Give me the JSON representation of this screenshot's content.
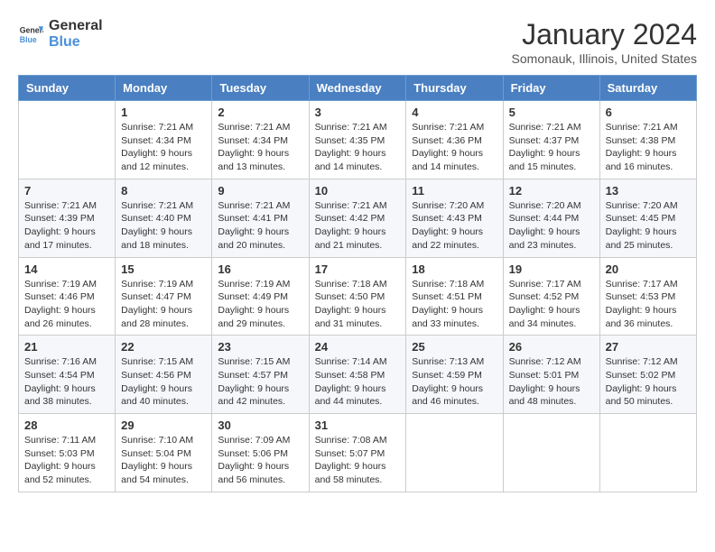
{
  "header": {
    "logo_line1": "General",
    "logo_line2": "Blue",
    "month_title": "January 2024",
    "location": "Somonauk, Illinois, United States"
  },
  "days_of_week": [
    "Sunday",
    "Monday",
    "Tuesday",
    "Wednesday",
    "Thursday",
    "Friday",
    "Saturday"
  ],
  "weeks": [
    [
      {
        "day": "",
        "info": ""
      },
      {
        "day": "1",
        "info": "Sunrise: 7:21 AM\nSunset: 4:34 PM\nDaylight: 9 hours and 12 minutes."
      },
      {
        "day": "2",
        "info": "Sunrise: 7:21 AM\nSunset: 4:34 PM\nDaylight: 9 hours and 13 minutes."
      },
      {
        "day": "3",
        "info": "Sunrise: 7:21 AM\nSunset: 4:35 PM\nDaylight: 9 hours and 14 minutes."
      },
      {
        "day": "4",
        "info": "Sunrise: 7:21 AM\nSunset: 4:36 PM\nDaylight: 9 hours and 14 minutes."
      },
      {
        "day": "5",
        "info": "Sunrise: 7:21 AM\nSunset: 4:37 PM\nDaylight: 9 hours and 15 minutes."
      },
      {
        "day": "6",
        "info": "Sunrise: 7:21 AM\nSunset: 4:38 PM\nDaylight: 9 hours and 16 minutes."
      }
    ],
    [
      {
        "day": "7",
        "info": "Sunrise: 7:21 AM\nSunset: 4:39 PM\nDaylight: 9 hours and 17 minutes."
      },
      {
        "day": "8",
        "info": "Sunrise: 7:21 AM\nSunset: 4:40 PM\nDaylight: 9 hours and 18 minutes."
      },
      {
        "day": "9",
        "info": "Sunrise: 7:21 AM\nSunset: 4:41 PM\nDaylight: 9 hours and 20 minutes."
      },
      {
        "day": "10",
        "info": "Sunrise: 7:21 AM\nSunset: 4:42 PM\nDaylight: 9 hours and 21 minutes."
      },
      {
        "day": "11",
        "info": "Sunrise: 7:20 AM\nSunset: 4:43 PM\nDaylight: 9 hours and 22 minutes."
      },
      {
        "day": "12",
        "info": "Sunrise: 7:20 AM\nSunset: 4:44 PM\nDaylight: 9 hours and 23 minutes."
      },
      {
        "day": "13",
        "info": "Sunrise: 7:20 AM\nSunset: 4:45 PM\nDaylight: 9 hours and 25 minutes."
      }
    ],
    [
      {
        "day": "14",
        "info": "Sunrise: 7:19 AM\nSunset: 4:46 PM\nDaylight: 9 hours and 26 minutes."
      },
      {
        "day": "15",
        "info": "Sunrise: 7:19 AM\nSunset: 4:47 PM\nDaylight: 9 hours and 28 minutes."
      },
      {
        "day": "16",
        "info": "Sunrise: 7:19 AM\nSunset: 4:49 PM\nDaylight: 9 hours and 29 minutes."
      },
      {
        "day": "17",
        "info": "Sunrise: 7:18 AM\nSunset: 4:50 PM\nDaylight: 9 hours and 31 minutes."
      },
      {
        "day": "18",
        "info": "Sunrise: 7:18 AM\nSunset: 4:51 PM\nDaylight: 9 hours and 33 minutes."
      },
      {
        "day": "19",
        "info": "Sunrise: 7:17 AM\nSunset: 4:52 PM\nDaylight: 9 hours and 34 minutes."
      },
      {
        "day": "20",
        "info": "Sunrise: 7:17 AM\nSunset: 4:53 PM\nDaylight: 9 hours and 36 minutes."
      }
    ],
    [
      {
        "day": "21",
        "info": "Sunrise: 7:16 AM\nSunset: 4:54 PM\nDaylight: 9 hours and 38 minutes."
      },
      {
        "day": "22",
        "info": "Sunrise: 7:15 AM\nSunset: 4:56 PM\nDaylight: 9 hours and 40 minutes."
      },
      {
        "day": "23",
        "info": "Sunrise: 7:15 AM\nSunset: 4:57 PM\nDaylight: 9 hours and 42 minutes."
      },
      {
        "day": "24",
        "info": "Sunrise: 7:14 AM\nSunset: 4:58 PM\nDaylight: 9 hours and 44 minutes."
      },
      {
        "day": "25",
        "info": "Sunrise: 7:13 AM\nSunset: 4:59 PM\nDaylight: 9 hours and 46 minutes."
      },
      {
        "day": "26",
        "info": "Sunrise: 7:12 AM\nSunset: 5:01 PM\nDaylight: 9 hours and 48 minutes."
      },
      {
        "day": "27",
        "info": "Sunrise: 7:12 AM\nSunset: 5:02 PM\nDaylight: 9 hours and 50 minutes."
      }
    ],
    [
      {
        "day": "28",
        "info": "Sunrise: 7:11 AM\nSunset: 5:03 PM\nDaylight: 9 hours and 52 minutes."
      },
      {
        "day": "29",
        "info": "Sunrise: 7:10 AM\nSunset: 5:04 PM\nDaylight: 9 hours and 54 minutes."
      },
      {
        "day": "30",
        "info": "Sunrise: 7:09 AM\nSunset: 5:06 PM\nDaylight: 9 hours and 56 minutes."
      },
      {
        "day": "31",
        "info": "Sunrise: 7:08 AM\nSunset: 5:07 PM\nDaylight: 9 hours and 58 minutes."
      },
      {
        "day": "",
        "info": ""
      },
      {
        "day": "",
        "info": ""
      },
      {
        "day": "",
        "info": ""
      }
    ]
  ]
}
